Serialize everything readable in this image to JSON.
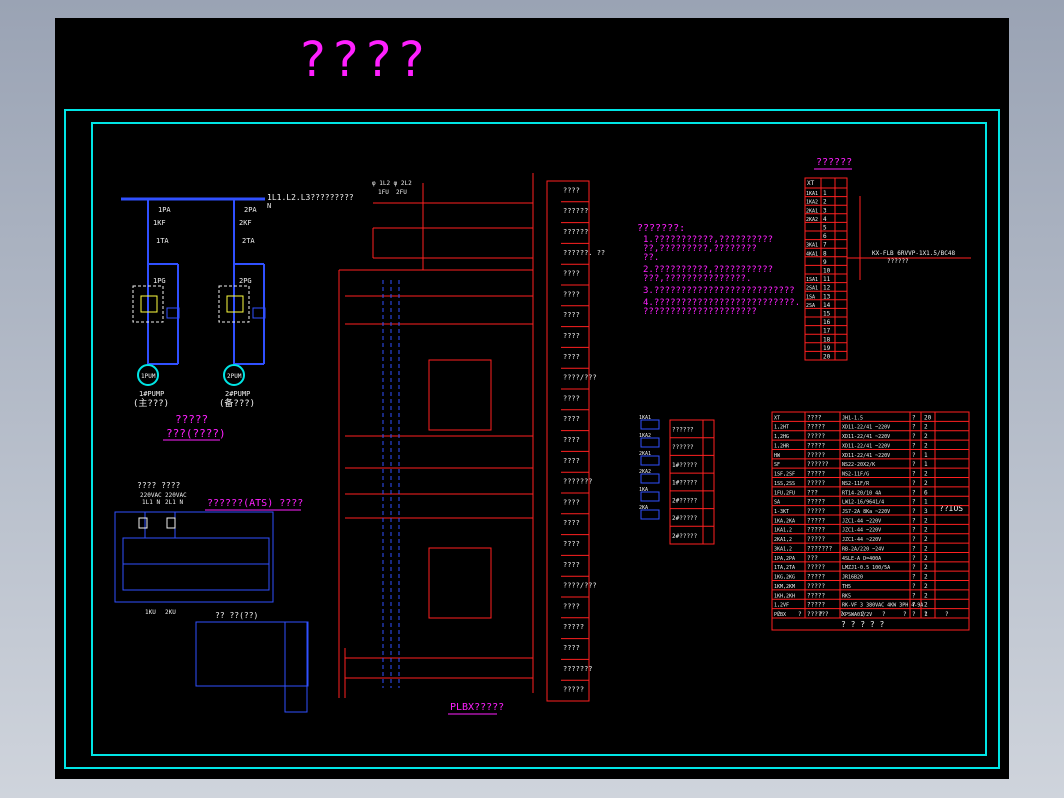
{
  "title": "????",
  "colors": {
    "cyan": "#00e5e5",
    "red": "#ff2020",
    "blue": "#3050ff",
    "magenta": "#ff20ff",
    "white": "#f0f0f0",
    "green": "#20ff40",
    "yellow": "#ffff40",
    "bg": "#000000"
  },
  "left": {
    "bus_label": "1L1.L2.L3?????????",
    "bus_n": "N",
    "qf1": "1PA",
    "qf2": "2PA",
    "ka1": "1KF",
    "ka2": "2KF",
    "ta1": "1TA",
    "ta2": "2TA",
    "vfd1": "1PG",
    "vfd2": "2PG",
    "motor1": "1PUM",
    "motor2": "2PUM",
    "pump1_cap": "1#PUMP",
    "pump1_sub": "(主???)",
    "pump2_cap": "2#PUMP",
    "pump2_sub": "(备???)",
    "block_title": "?????",
    "block_sub": "???(????)"
  },
  "ats": {
    "header": "???? ????",
    "v1": "220VAC",
    "v2": "220VAC",
    "l1": "1L1  N",
    "l2": "2L1  N",
    "title": "??????(ATS) ????",
    "ku1": "1KU",
    "ku2": "2KU",
    "sub_label": "?? ??(??)"
  },
  "middle": {
    "fu1": "1FU",
    "fu2": "2FU",
    "top_label": "φ 1L2 φ 2L2",
    "side_labels": [
      "????",
      "??????",
      "??????",
      "??????. ??",
      "????",
      "????",
      "????",
      "????",
      "????",
      "????/???",
      "????",
      "????",
      "????",
      "????",
      "???????",
      "????",
      "????",
      "????",
      "????",
      "????/???",
      "????",
      "?????",
      "????",
      "???????",
      "?????"
    ],
    "caption": "PLBX?????"
  },
  "notes": {
    "title": "???????:",
    "lines": [
      "1.???????????,??????????",
      "  ??,?????????,????????",
      "  ??.",
      "2.??????????,???????????",
      "  ???,???????????????.",
      "3.??????????????????????????",
      "4.??????????????????????????.",
      "  ?????????????????????"
    ]
  },
  "terminal": {
    "title": "??????",
    "header": "XT",
    "labels": [
      "1KA1",
      "1KA2",
      "2KA1",
      "2KA2",
      "",
      "",
      "3KA1",
      "4KA1",
      "",
      "",
      "1SA1",
      "2SA1",
      "1SA",
      "2SA"
    ],
    "numbers": [
      "1",
      "2",
      "3",
      "4",
      "5",
      "6",
      "7",
      "8",
      "9",
      "10",
      "11",
      "12",
      "13",
      "14",
      "15",
      "16",
      "17",
      "18",
      "19",
      "20"
    ],
    "cable_note": "KX-FLB 6RVVP-1X1.5/BC48",
    "cable_sub": "??????"
  },
  "small_table": {
    "labels": [
      "1KA1",
      "1KA2",
      "2KA1",
      "2KA2",
      "1KA",
      "2KA"
    ],
    "rows": [
      "??????",
      "??????",
      "1#?????",
      "1#?????",
      "2#?????",
      "2#?????",
      "2#?????"
    ]
  },
  "parts": {
    "rows": [
      [
        "XT",
        "????",
        "JH1-1.5",
        "?",
        "20"
      ],
      [
        "1,2HT",
        "?????",
        "XD11-22/41   ~220V",
        "?",
        "2"
      ],
      [
        "1,2HG",
        "?????",
        "XD11-22/41   ~220V",
        "?",
        "2"
      ],
      [
        "1,2HR",
        "?????",
        "XD11-22/41   ~220V",
        "?",
        "2"
      ],
      [
        "HW",
        "?????",
        "XD11-22/41   ~220V",
        "?",
        "1"
      ],
      [
        "SF",
        "??????",
        "NS22-20X2/K",
        "?",
        "1"
      ],
      [
        "1SF,2SF",
        "?????",
        "NS2-11F/G",
        "?",
        "2"
      ],
      [
        "1SS,2SS",
        "?????",
        "NS2-11F/R",
        "?",
        "2"
      ],
      [
        "1FU,2FU",
        "???",
        "RT14-20/10    4A",
        "?",
        "6"
      ],
      [
        "SA",
        "?????",
        "LW12-16/9641/4",
        "?",
        "1"
      ],
      [
        "1-3KT",
        "?????",
        "JS7-2A 8Ka   ~220V",
        "?",
        "3"
      ],
      [
        "1KA,2KA",
        "?????",
        "JZC1-44     ~220V",
        "?",
        "2"
      ],
      [
        "1KA1,2",
        "?????",
        "JZC1-44     ~220V",
        "?",
        "2"
      ],
      [
        "2KA1,2",
        "?????",
        "JZC1-44     ~220V",
        "?",
        "2"
      ],
      [
        "3KA1,2",
        "???????",
        "RB-2A/220   ~24V",
        "?",
        "2"
      ],
      [
        "1PA,2PA",
        "???",
        "4SLE-A  D=400A",
        "?",
        "2"
      ],
      [
        "1TA,2TA",
        "?????",
        "LMZJ1-0.5 100/5A",
        "?",
        "2"
      ],
      [
        "1KG,2KG",
        "?????",
        "JR16B20",
        "?",
        "2"
      ],
      [
        "1KM,2KM",
        "?????",
        "TH5",
        "?",
        "2"
      ],
      [
        "1KH,2KH",
        "?????",
        "RK5",
        "?",
        "2"
      ],
      [
        "1,2VF",
        "?????",
        "RK-VF 3 380VAC 4KW 3PH 4-9A",
        "?",
        "2"
      ],
      [
        "PLBX",
        "??????",
        "XPSWA01/2V",
        "?",
        "1"
      ]
    ],
    "foot": [
      "?",
      "?",
      "?",
      "?",
      "?",
      "?",
      "?",
      "?",
      "?"
    ],
    "footer": "? ? ? ? ?",
    "side_note": "??IOS"
  }
}
